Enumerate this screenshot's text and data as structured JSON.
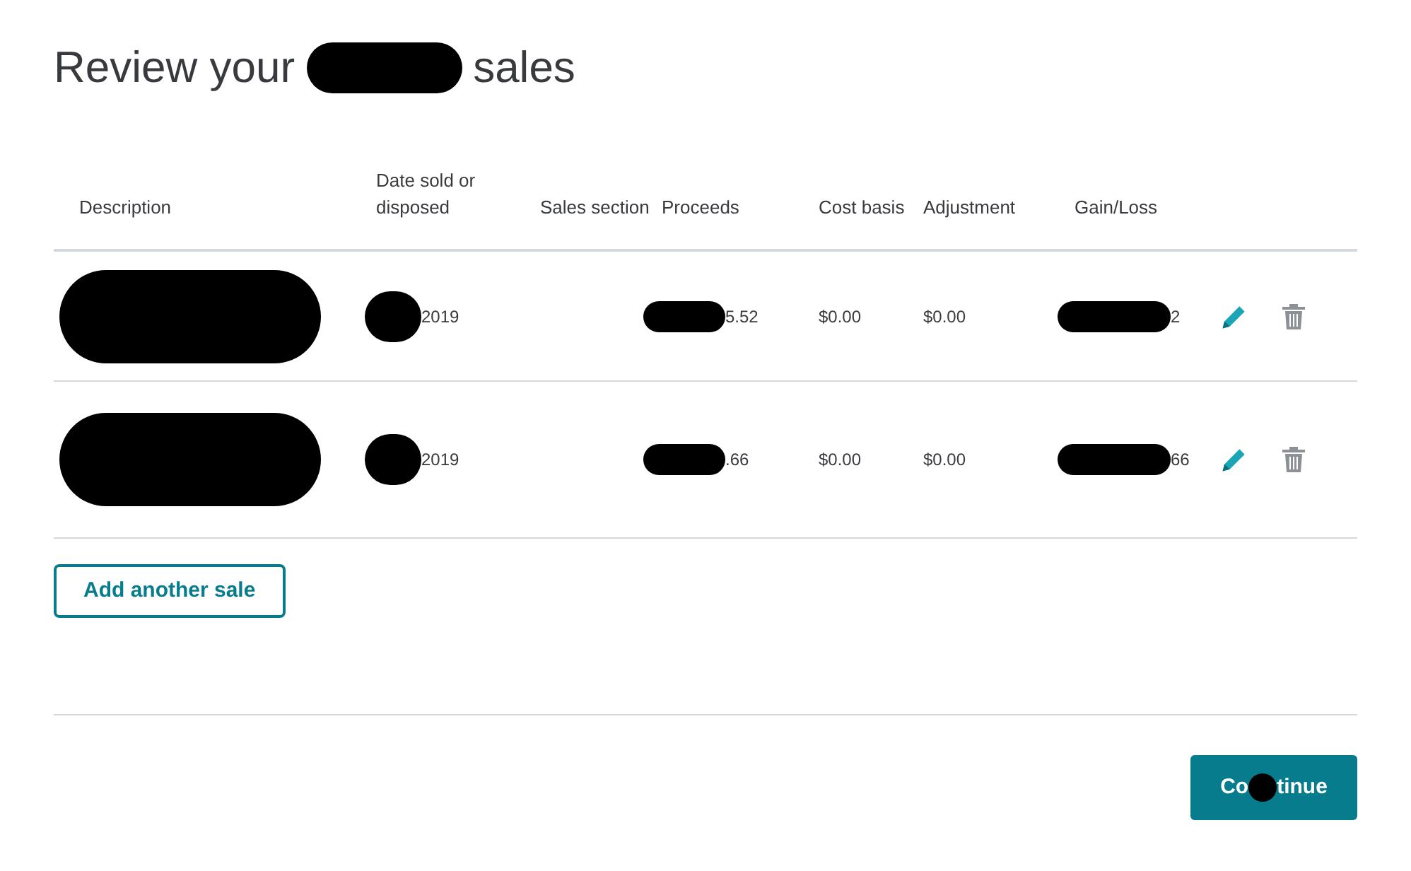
{
  "title": {
    "before": "Review your",
    "after": "sales"
  },
  "table": {
    "columns": [
      "Description",
      "Date sold or disposed",
      "Sales section",
      "Proceeds",
      "Cost basis",
      "Adjustment",
      "Gain/Loss"
    ],
    "rows": [
      {
        "date_sold": "2019",
        "proceeds": "5.52",
        "cost_basis": "$0.00",
        "adjustment": "$0.00",
        "gain_loss": "2"
      },
      {
        "date_sold": "2019",
        "proceeds": ".66",
        "cost_basis": "$0.00",
        "adjustment": "$0.00",
        "gain_loss": "66"
      }
    ]
  },
  "add_button": "Add another sale",
  "continue_button": {
    "label_parts": [
      "Co",
      "tinue"
    ]
  }
}
